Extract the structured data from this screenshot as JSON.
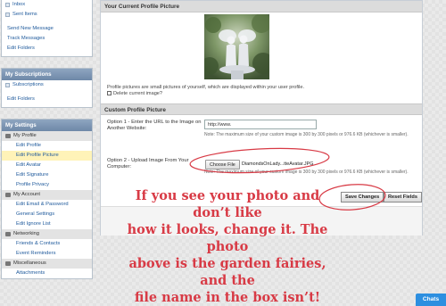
{
  "sidebar": {
    "messages": {
      "items": [
        {
          "label": "Inbox"
        },
        {
          "label": "Sent Items"
        },
        {
          "label": "Send New Message"
        },
        {
          "label": "Track Messages"
        },
        {
          "label": "Edit Folders"
        }
      ]
    },
    "subscriptions": {
      "title": "My Subscriptions",
      "items": [
        {
          "label": "Subscriptions"
        },
        {
          "label": "Edit Folders"
        }
      ]
    },
    "settings": {
      "title": "My Settings",
      "group_profile": "My Profile",
      "profile_items": [
        "Edit Profile",
        "Edit Profile Picture",
        "Edit Avatar",
        "Edit Signature",
        "Profile Privacy"
      ],
      "group_account": "My Account",
      "account_items": [
        "Edit Email & Password",
        "General Settings",
        "Edit Ignore List"
      ],
      "group_networking": "Networking",
      "networking_items": [
        "Friends & Contacts",
        "Event Reminders"
      ],
      "group_misc": "Miscellaneous",
      "misc_items": [
        "Attachments"
      ]
    }
  },
  "main": {
    "current_title": "Your Current Profile Picture",
    "current_note": "Profile pictures are small pictures of yourself, which are displayed within your user profile.",
    "delete_label": "Delete current image?",
    "custom_title": "Custom Profile Picture",
    "option1_label": "Option 1 - Enter the URL to the Image on Another Website:",
    "option1_value": "http://www.",
    "option1_note": "Note: The maximum size of your custom image is 300 by 300 pixels or 976.6 KB (whichever is smaller).",
    "option2_label": "Option 2 - Upload Image From Your Computer:",
    "choose_file": "Choose File",
    "file_name": "DiamondsOnLady...tteAvatar.JPG",
    "option2_note": "Note: The maximum size of your custom image is 300 by 300 pixels or 976.6 KB (whichever is smaller).",
    "save_button": "Save Changes",
    "reset_button": "Reset Fields"
  },
  "annotation": {
    "lines": [
      "If you see your photo and don’t like",
      "how it looks, change it. The photo",
      "above is the garden fairies, and the",
      "file name in the box isn’t!"
    ],
    "color": "#d83a45"
  },
  "chat": {
    "label": "Chats",
    "color": "#2d8fe0"
  }
}
